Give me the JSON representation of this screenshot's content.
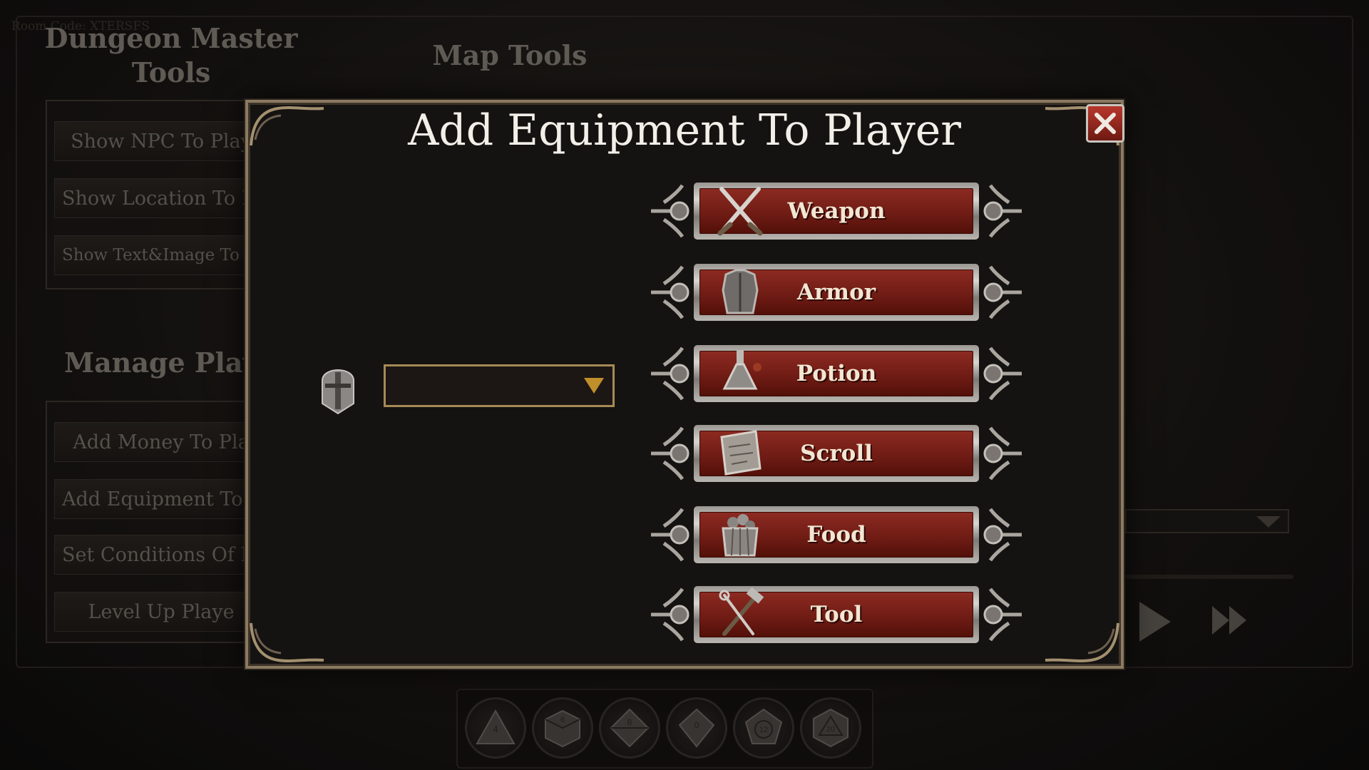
{
  "room_code": "Room Code: XTERSFS",
  "dm_tools": {
    "title": "Dungeon Master Tools",
    "buttons": [
      "Show NPC To Play",
      "Show Location To Pl",
      "Show Text&Image To P"
    ]
  },
  "map_tools": {
    "title": "Map Tools"
  },
  "manage_players": {
    "title": "Manage Playe",
    "buttons": [
      "Add Money To Pla",
      "Add Equipment To P",
      "Set Conditions Of P",
      "Level Up Playe"
    ]
  },
  "modal": {
    "title": "Add Equipment To Player",
    "player_select_value": "",
    "buttons": [
      {
        "label": "Weapon",
        "icon": "crossed-swords-icon"
      },
      {
        "label": "Armor",
        "icon": "armor-icon"
      },
      {
        "label": "Potion",
        "icon": "potion-icon"
      },
      {
        "label": "Scroll",
        "icon": "scroll-icon"
      },
      {
        "label": "Food",
        "icon": "food-icon"
      },
      {
        "label": "Tool",
        "icon": "tool-icon"
      }
    ]
  },
  "dice": [
    {
      "icon": "d4-icon",
      "label": "4"
    },
    {
      "icon": "d6-icon",
      "label": "6"
    },
    {
      "icon": "d8-icon",
      "label": "8"
    },
    {
      "icon": "d10-icon",
      "label": "0"
    },
    {
      "icon": "d12-icon",
      "label": "12"
    },
    {
      "icon": "d20-icon",
      "label": "20"
    }
  ],
  "colors": {
    "modal_border": "#8b7a61",
    "button_red": "#7a2018",
    "select_border": "#a68a55",
    "dropdown_arrow": "#c08e2a",
    "close_red": "#b8372c"
  }
}
